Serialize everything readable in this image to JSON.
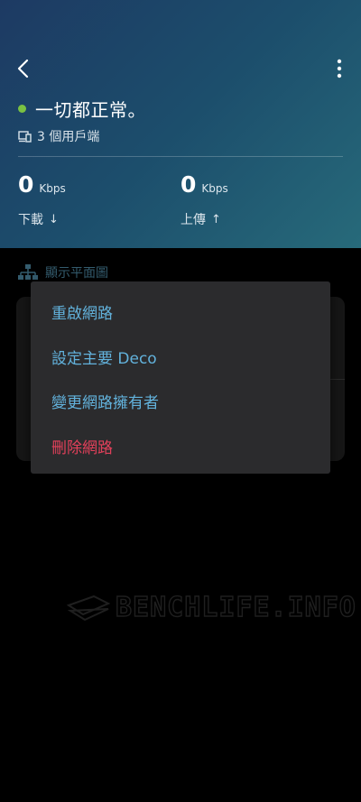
{
  "header": {
    "status_text": "一切都正常。",
    "clients_text": "3 個用戶端",
    "download": {
      "value": "0",
      "unit": "Kbps",
      "label": "下載",
      "arrow": "↓"
    },
    "upload": {
      "value": "0",
      "unit": "Kbps",
      "label": "上傳",
      "arrow": "↑"
    }
  },
  "floorplan": {
    "label": "顯示平面圖"
  },
  "menu": {
    "items": [
      {
        "label": "重啟網路",
        "variant": "normal"
      },
      {
        "label": "設定主要 Deco",
        "variant": "normal"
      },
      {
        "label": "變更網路擁有者",
        "variant": "normal"
      },
      {
        "label": "刪除網路",
        "variant": "danger"
      }
    ]
  },
  "watermark": {
    "text": "BENCHLIFE.INFO"
  },
  "colors": {
    "status_green": "#7ac142",
    "menu_text": "#62b2dc",
    "menu_danger": "#e2405a",
    "menu_bg": "#2b2b2d"
  },
  "icons": {
    "back": "chevron-left-icon",
    "more": "more-vertical-icon",
    "clients": "device-icon",
    "floorplan": "network-tree-icon"
  }
}
